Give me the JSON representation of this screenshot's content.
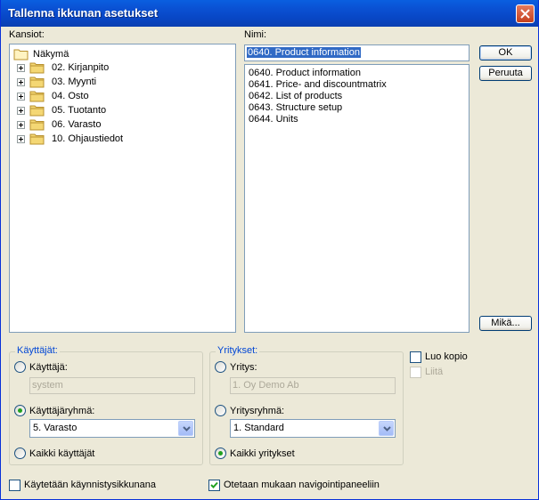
{
  "window": {
    "title": "Tallenna ikkunan asetukset"
  },
  "folders": {
    "label": "Kansiot:",
    "root": "Näkymä",
    "items": [
      "02. Kirjanpito",
      "03. Myynti",
      "04. Osto",
      "05. Tuotanto",
      "06. Varasto",
      "10. Ohjaustiedot"
    ]
  },
  "name": {
    "label": "Nimi:",
    "value": "0640. Product information",
    "items": [
      "0640. Product information",
      "0641. Price- and discountmatrix",
      "0642. List of products",
      "0643. Structure setup",
      "0644. Units"
    ]
  },
  "buttons": {
    "ok": "OK",
    "cancel": "Peruuta",
    "what": "Mikä..."
  },
  "users": {
    "legend": "Käyttäjät:",
    "user_label": "Käyttäjä:",
    "user_value": "system",
    "group_label": "Käyttäjäryhmä:",
    "group_value": "5. Varasto",
    "all_label": "Kaikki käyttäjät",
    "selected": "group"
  },
  "companies": {
    "legend": "Yritykset:",
    "company_label": "Yritys:",
    "company_value": "1. Oy Demo Ab",
    "group_label": "Yritysryhmä:",
    "group_value": "1. Standard",
    "all_label": "Kaikki yritykset",
    "selected": "all"
  },
  "options": {
    "copy_label": "Luo kopio",
    "copy_checked": false,
    "attach_label": "Liitä",
    "attach_enabled": false,
    "startup_label": "Käytetään käynnistysikkunana",
    "startup_checked": false,
    "nav_label": "Otetaan mukaan navigointipaneeliin",
    "nav_checked": true
  },
  "colors": {
    "title_bar": "#0a52d4",
    "legend_text": "#0046d5",
    "selection": "#316ac5"
  }
}
